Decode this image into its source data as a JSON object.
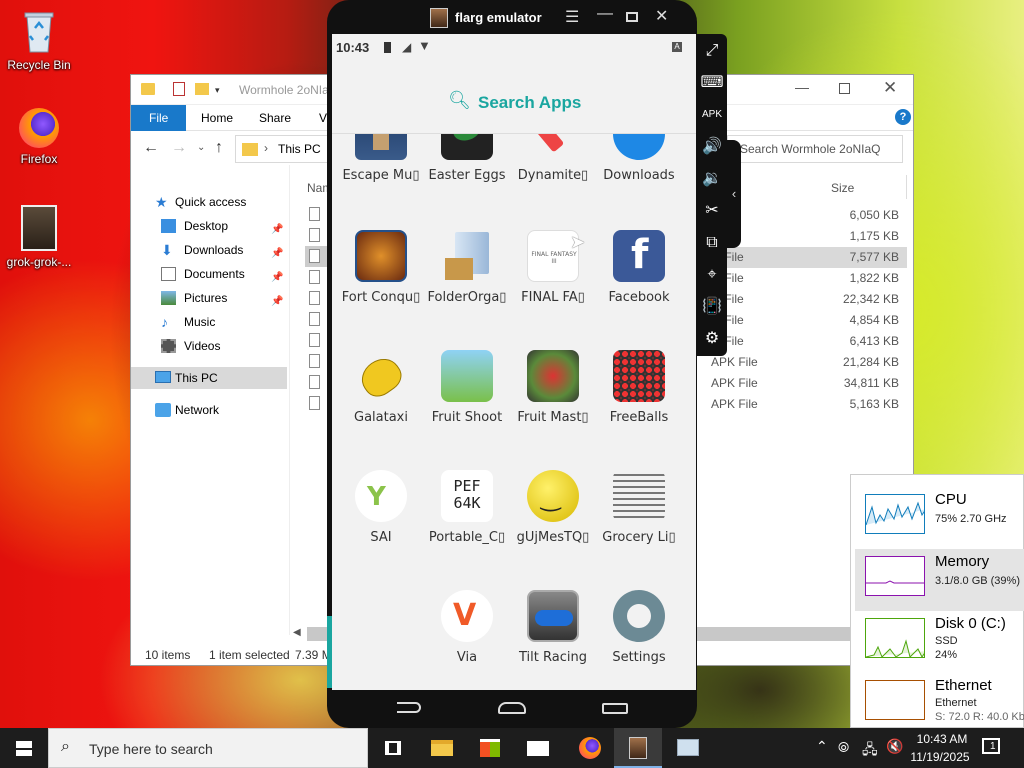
{
  "desktop": {
    "icons": [
      {
        "label": "Recycle Bin",
        "icon": "recycle-bin-icon"
      },
      {
        "label": "Firefox",
        "icon": "firefox-icon"
      },
      {
        "label": "grok-grok-...",
        "icon": "image-file-icon"
      }
    ]
  },
  "explorer": {
    "title": "Wormhole 2oNIaQ",
    "tabs": [
      "File",
      "Home",
      "Share",
      "Vi"
    ],
    "address": "This PC",
    "search_placeholder": "Search Wormhole 2oNIaQ",
    "col_name": "Nam",
    "col_size": "Size",
    "nav": {
      "quick_access": "Quick access",
      "items": [
        {
          "label": "Desktop",
          "icon": "desktop-folder-icon",
          "pinned": true
        },
        {
          "label": "Downloads",
          "icon": "download-icon",
          "pinned": true
        },
        {
          "label": "Documents",
          "icon": "documents-icon",
          "pinned": true
        },
        {
          "label": "Pictures",
          "icon": "pictures-icon",
          "pinned": true
        },
        {
          "label": "Music",
          "icon": "music-icon",
          "pinned": false
        },
        {
          "label": "Videos",
          "icon": "videos-icon",
          "pinned": false
        }
      ],
      "this_pc": "This PC",
      "network": "Network"
    },
    "files": [
      {
        "type": "ile",
        "size": "6,050 KB"
      },
      {
        "type": "ile",
        "size": "1,175 KB"
      },
      {
        "type": "PK File",
        "size": "7,577 KB"
      },
      {
        "type": "PK File",
        "size": "1,822 KB"
      },
      {
        "type": "PK File",
        "size": "22,342 KB"
      },
      {
        "type": "PK File",
        "size": "4,854 KB"
      },
      {
        "type": "PK File",
        "size": "6,413 KB"
      },
      {
        "type": "APK File",
        "size": "21,284 KB"
      },
      {
        "type": "APK File",
        "size": "34,811 KB"
      },
      {
        "type": "APK File",
        "size": "5,163 KB"
      }
    ],
    "status": {
      "count": "10 items",
      "selected": "1 item selected",
      "size": "7.39 M"
    }
  },
  "emulator": {
    "title": "flarg emulator",
    "status_time": "10:43",
    "search_label": "Search Apps",
    "apps": [
      {
        "label": "Escape Mu▯",
        "icon": "escape-museum-icon"
      },
      {
        "label": "Easter Eggs",
        "icon": "easter-eggs-icon"
      },
      {
        "label": "Dynamite▯",
        "icon": "dynamite-icon"
      },
      {
        "label": "Downloads",
        "icon": "downloads-app-icon"
      },
      {
        "label": "Fort Conqu▯",
        "icon": "fort-conquer-icon"
      },
      {
        "label": "FolderOrga▯",
        "icon": "folder-organizer-icon"
      },
      {
        "label": "FINAL FA▯",
        "icon": "final-fantasy-icon",
        "art_text": "FINAL FANTASY III"
      },
      {
        "label": "Facebook",
        "icon": "facebook-icon",
        "art_text": "f"
      },
      {
        "label": "Galataxi",
        "icon": "galataxi-icon"
      },
      {
        "label": "Fruit Shoot",
        "icon": "fruit-shoot-icon"
      },
      {
        "label": "Fruit Mast▯",
        "icon": "fruit-master-icon"
      },
      {
        "label": "FreeBalls",
        "icon": "freeballs-icon"
      },
      {
        "label": "SAI",
        "icon": "sai-icon"
      },
      {
        "label": "Portable_C▯",
        "icon": "portable-c64-icon",
        "art_text": "PEF 64K"
      },
      {
        "label": "gUjMesTQ▯",
        "icon": "smiley-icon"
      },
      {
        "label": "Grocery Li▯",
        "icon": "grocery-list-icon"
      },
      {
        "label": "Via",
        "icon": "via-browser-icon"
      },
      {
        "label": "Tilt Racing",
        "icon": "tilt-racing-icon"
      },
      {
        "label": "Settings",
        "icon": "settings-gear-icon"
      }
    ]
  },
  "taskmgr": {
    "cpu": {
      "label": "CPU",
      "detail": "75%  2.70 GHz"
    },
    "memory": {
      "label": "Memory",
      "detail": "3.1/8.0 GB (39%)"
    },
    "disk": {
      "label": "Disk 0 (C:)",
      "type": "SSD",
      "detail": "24%"
    },
    "ethernet": {
      "label": "Ethernet",
      "type": "Ethernet",
      "detail": "S: 72.0  R: 40.0 Kb"
    }
  },
  "taskbar": {
    "search_placeholder": "Type here to search",
    "time": "10:43 AM",
    "date": "11/19/2025",
    "notification_count": "1"
  },
  "colors": {
    "explorer_blue": "#1979ca",
    "teal": "#1aa6a0",
    "taskbar": "#1d1d1d",
    "memory": "#8b12ae",
    "cpu": "#117dbb",
    "disk": "#4da60c",
    "ethernet": "#a74f01"
  }
}
